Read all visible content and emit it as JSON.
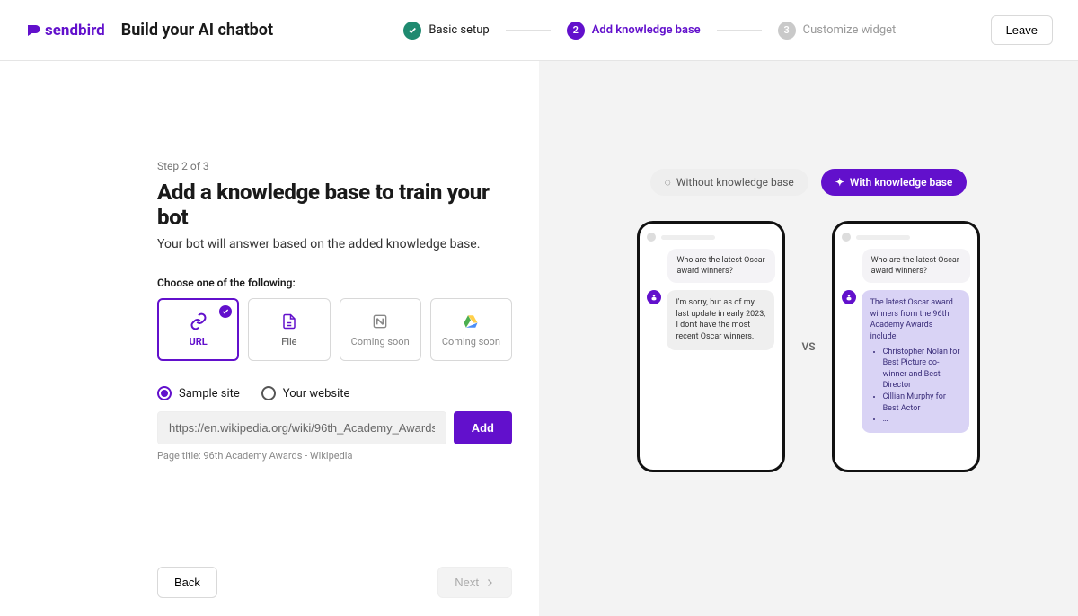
{
  "header": {
    "brand": "sendbird",
    "page_title": "Build your AI chatbot",
    "leave": "Leave"
  },
  "stepper": {
    "steps": [
      {
        "label": "Basic setup",
        "state": "done"
      },
      {
        "label": "Add knowledge base",
        "state": "active",
        "num": "2"
      },
      {
        "label": "Customize widget",
        "state": "idle",
        "num": "3"
      }
    ]
  },
  "left": {
    "step_count": "Step 2 of 3",
    "heading": "Add a knowledge base to train your bot",
    "subhead": "Your bot will answer based on the added knowledge base.",
    "choose_label": "Choose one of the following:",
    "cards": {
      "url": "URL",
      "file": "File",
      "coming_soon": "Coming soon"
    },
    "radios": {
      "sample": "Sample site",
      "own": "Your website"
    },
    "url_value": "https://en.wikipedia.org/wiki/96th_Academy_Awards",
    "add": "Add",
    "hint": "Page title: 96th Academy Awards - Wikipedia",
    "back": "Back",
    "next": "Next"
  },
  "right": {
    "toggle_off": "Without knowledge base",
    "toggle_on": "With knowledge base",
    "vs": "VS",
    "question": "Who are the latest Oscar award winners?",
    "answer_plain": "I'm sorry, but as of my last update in early 2023, I don't have the most recent Oscar winners.",
    "answer_kb_intro": "The latest Oscar award winners from the 96th Academy Awards include:",
    "answer_kb_list": [
      "Christopher Nolan for Best Picture co-winner and Best Director",
      "Cillian Murphy for Best Actor",
      "…"
    ]
  }
}
